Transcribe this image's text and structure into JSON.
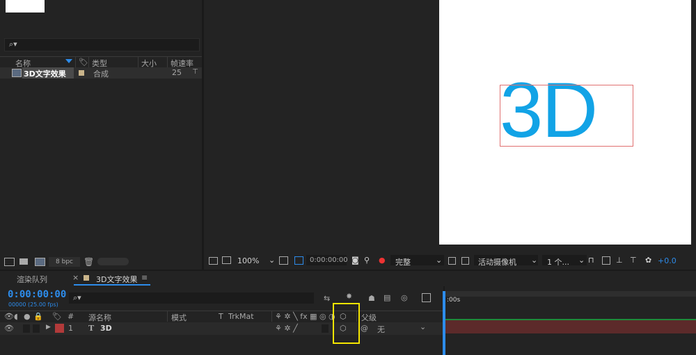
{
  "project": {
    "search_placeholder": "",
    "columns": {
      "name": "名称",
      "type": "类型",
      "size": "大小",
      "fps": "帧速率"
    },
    "item": {
      "name": "3D文字效果",
      "type": "合成",
      "fps": "25"
    },
    "bpc": "8 bpc"
  },
  "composition": {
    "text": "3D",
    "text_color": "#12a3e6"
  },
  "viewer": {
    "zoom": "100%",
    "timecode": "0:00:00:00",
    "resolution": "完整",
    "camera": "活动摄像机",
    "views": "1 个...",
    "exposure": "+0.0"
  },
  "tabs": {
    "render_queue": "渲染队列",
    "close": "×",
    "comp_tab": "3D文字效果",
    "menu": "≡"
  },
  "timeline": {
    "timecode": "0:00:00:00",
    "fps_info": "00000 (25.00 fps)",
    "columns": {
      "hash": "#",
      "source_name": "源名称",
      "mode": "模式",
      "t": "T",
      "trkmat": "TrkMat",
      "parent": "父级"
    },
    "layer": {
      "num": "1",
      "type_glyph": "T",
      "name": "3D",
      "parent": "无"
    },
    "ruler_label": ":00s"
  }
}
